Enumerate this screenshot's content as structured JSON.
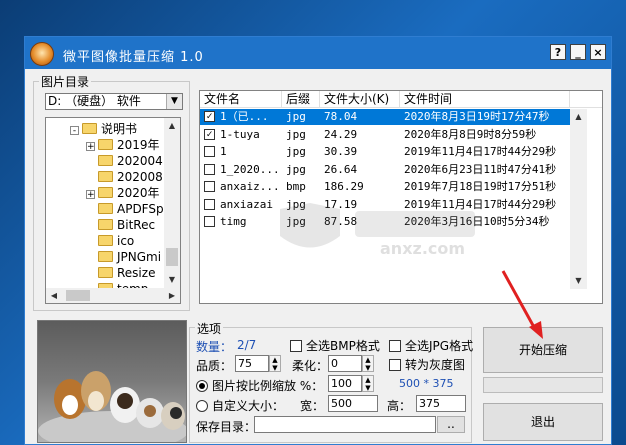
{
  "window": {
    "title": "微平图像批量压缩 1.0",
    "help_btn": "?",
    "min_btn": "_",
    "close_btn": "×"
  },
  "left_panel": {
    "group_label": "图片目录",
    "drive": "D: （硬盘） 软件",
    "tree": [
      {
        "label": "说明书",
        "expander": "-",
        "level": 0
      },
      {
        "label": "2019年",
        "expander": "+",
        "level": 1
      },
      {
        "label": "202004",
        "expander": "",
        "level": 1
      },
      {
        "label": "202008",
        "expander": "",
        "level": 1
      },
      {
        "label": "2020年",
        "expander": "+",
        "level": 1
      },
      {
        "label": "APDFSp",
        "expander": "",
        "level": 1
      },
      {
        "label": "BitRec",
        "expander": "",
        "level": 1
      },
      {
        "label": "ico",
        "expander": "",
        "level": 1
      },
      {
        "label": "JPNGmi",
        "expander": "",
        "level": 1
      },
      {
        "label": "Resize",
        "expander": "",
        "level": 1
      },
      {
        "label": "temp",
        "expander": "",
        "level": 1
      }
    ]
  },
  "file_list": {
    "columns": [
      "文件名",
      "后缀",
      "文件大小(K)",
      "文件时间"
    ],
    "rows": [
      {
        "checked": true,
        "name": "1（已...",
        "ext": "jpg",
        "size": "78.04",
        "time": "2020年8月3日19时17分47秒",
        "selected": true
      },
      {
        "checked": true,
        "name": "1-tuya",
        "ext": "jpg",
        "size": "24.29",
        "time": "2020年8月8日9时8分59秒",
        "selected": false
      },
      {
        "checked": false,
        "name": "1",
        "ext": "jpg",
        "size": "30.39",
        "time": "2019年11月4日17时44分29秒",
        "selected": false
      },
      {
        "checked": false,
        "name": "1_2020...",
        "ext": "jpg",
        "size": "26.64",
        "time": "2020年6月23日11时47分41秒",
        "selected": false
      },
      {
        "checked": false,
        "name": "anxaiz...",
        "ext": "bmp",
        "size": "186.29",
        "time": "2019年7月18日19时17分51秒",
        "selected": false
      },
      {
        "checked": false,
        "name": "anxiazai",
        "ext": "jpg",
        "size": "17.19",
        "time": "2019年11月4日17时44分29秒",
        "selected": false
      },
      {
        "checked": false,
        "name": "timg",
        "ext": "jpg",
        "size": "87.58",
        "time": "2020年3月16日10时5分34秒",
        "selected": false
      }
    ]
  },
  "options": {
    "group_label": "选项",
    "count_label": "数量：",
    "count_value": "2/7",
    "select_bmp": "全选BMP格式",
    "select_jpg": "全选JPG格式",
    "quality_label": "品质：",
    "quality_value": "75",
    "soften_label": "柔化：",
    "soften_value": "0",
    "grayscale": "转为灰度图",
    "scale_radio": "图片按比例缩放 %：",
    "scale_value": "100",
    "dimensions": "500 * 375",
    "custom_radio": "自定义大小：",
    "width_label": "宽：",
    "width_value": "500",
    "height_label": "高：",
    "height_value": "375",
    "save_label": "保存目录：",
    "save_value": "",
    "browse": ".."
  },
  "buttons": {
    "start": "开始压缩",
    "exit": "退出"
  },
  "watermark": "anxz.com"
}
